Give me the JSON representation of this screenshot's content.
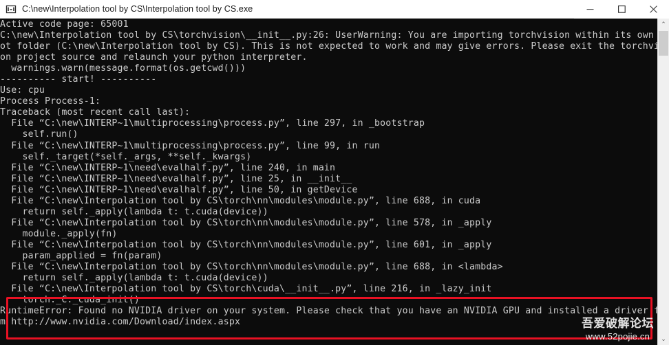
{
  "window": {
    "title": "C:\\new\\Interpolation tool by CS\\Interpolation tool by CS.exe",
    "icon": "console-icon",
    "minimize_label": "—",
    "maximize_label": "□",
    "close_label": "✕"
  },
  "scrollbar": {
    "up_arrow": "⌃",
    "down_arrow": "⌄"
  },
  "console": {
    "background": "#0c0c0c",
    "foreground": "#cccccc",
    "lines": [
      "Active code page: 65001",
      "C:\\new\\Interpolation tool by CS\\torchvision\\__init__.py:26: UserWarning: You are importing torchvision within its own ro",
      "ot folder (C:\\new\\Interpolation tool by CS). This is not expected to work and may give errors. Please exit the torchvisi",
      "on project source and relaunch your python interpreter.",
      "  warnings.warn(message.format(os.getcwd()))",
      "---------- start! ----------",
      "Use: cpu",
      "Process Process-1:",
      "Traceback (most recent call last):",
      "  File “C:\\new\\INTERP~1\\multiprocessing\\process.py”, line 297, in _bootstrap",
      "    self.run()",
      "  File “C:\\new\\INTERP~1\\multiprocessing\\process.py”, line 99, in run",
      "    self._target(*self._args, **self._kwargs)",
      "  File “C:\\new\\INTERP~1\\need\\evalhalf.py”, line 240, in main",
      "  File “C:\\new\\INTERP~1\\need\\evalhalf.py”, line 25, in __init__",
      "  File “C:\\new\\INTERP~1\\need\\evalhalf.py”, line 50, in getDevice",
      "  File “C:\\new\\Interpolation tool by CS\\torch\\nn\\modules\\module.py”, line 688, in cuda",
      "    return self._apply(lambda t: t.cuda(device))",
      "  File “C:\\new\\Interpolation tool by CS\\torch\\nn\\modules\\module.py”, line 578, in _apply",
      "    module._apply(fn)",
      "  File “C:\\new\\Interpolation tool by CS\\torch\\nn\\modules\\module.py”, line 601, in _apply",
      "    param_applied = fn(param)",
      "  File “C:\\new\\Interpolation tool by CS\\torch\\nn\\modules\\module.py”, line 688, in <lambda>",
      "    return self._apply(lambda t: t.cuda(device))",
      "  File “C:\\new\\Interpolation tool by CS\\torch\\cuda\\__init__.py”, line 216, in _lazy_init",
      "    torch._C._cuda_init()",
      "RuntimeError: Found no NVIDIA driver on your system. Please check that you have an NVIDIA GPU and installed a driver fro",
      "m http://www.nvidia.com/Download/index.aspx"
    ]
  },
  "annotation": {
    "color": "#e81123",
    "label": "error-highlight-box"
  },
  "watermark": {
    "chinese": "吾爱破解论坛",
    "url": "www.52pojie.cn"
  }
}
